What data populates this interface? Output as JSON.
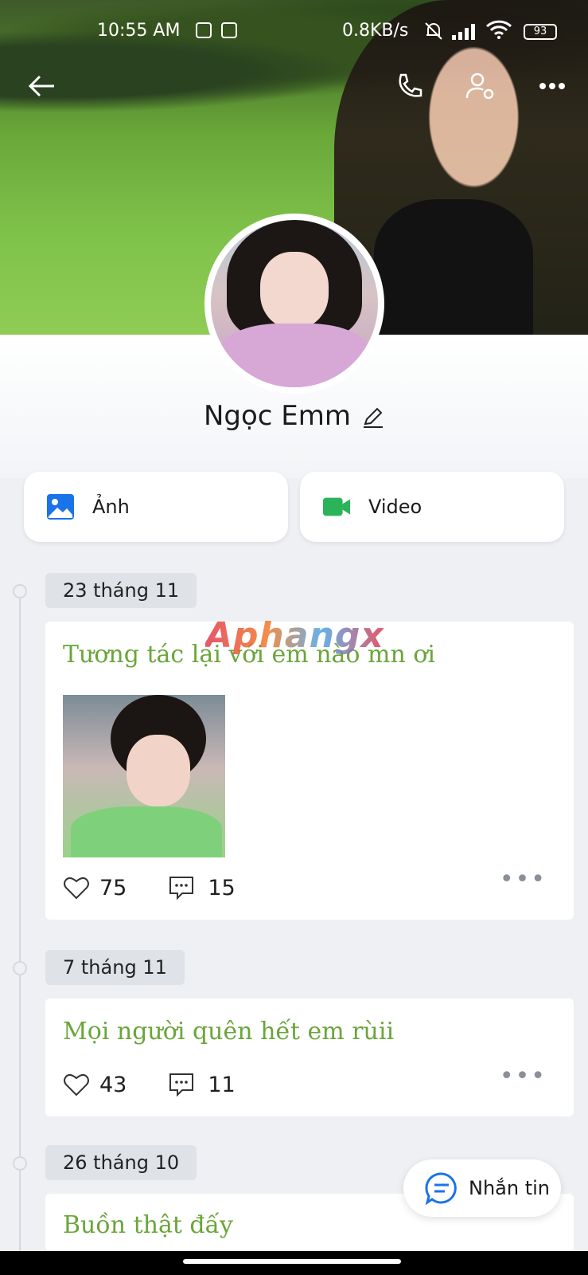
{
  "status_bar": {
    "time": "10:55 AM",
    "network_speed": "0.8KB/s",
    "battery": "93"
  },
  "header": {
    "back_icon": "arrow-left-icon",
    "call_icon": "phone-icon",
    "settings_icon": "user-settings-icon",
    "more_icon": "more-horizontal-icon"
  },
  "profile": {
    "name": "Ngọc Emm"
  },
  "media_buttons": {
    "photos_label": "Ảnh",
    "video_label": "Video",
    "photos_color": "#1a73e8",
    "video_color": "#2bb35a"
  },
  "watermark": "Aphangx",
  "posts": [
    {
      "date": "23 tháng 11",
      "caption": "Tương tác lại với em nào mn ơi",
      "likes": "75",
      "comments": "15"
    },
    {
      "date": "7 tháng 11",
      "caption": "Mọi người quên hết em rùii",
      "likes": "43",
      "comments": "11"
    },
    {
      "date": "26 tháng 10",
      "caption": "Buồn thật đấy"
    }
  ],
  "message_button": {
    "label": "Nhắn tin"
  },
  "colors": {
    "caption_green": "#6aa53a",
    "accent_blue": "#1a73e8"
  }
}
